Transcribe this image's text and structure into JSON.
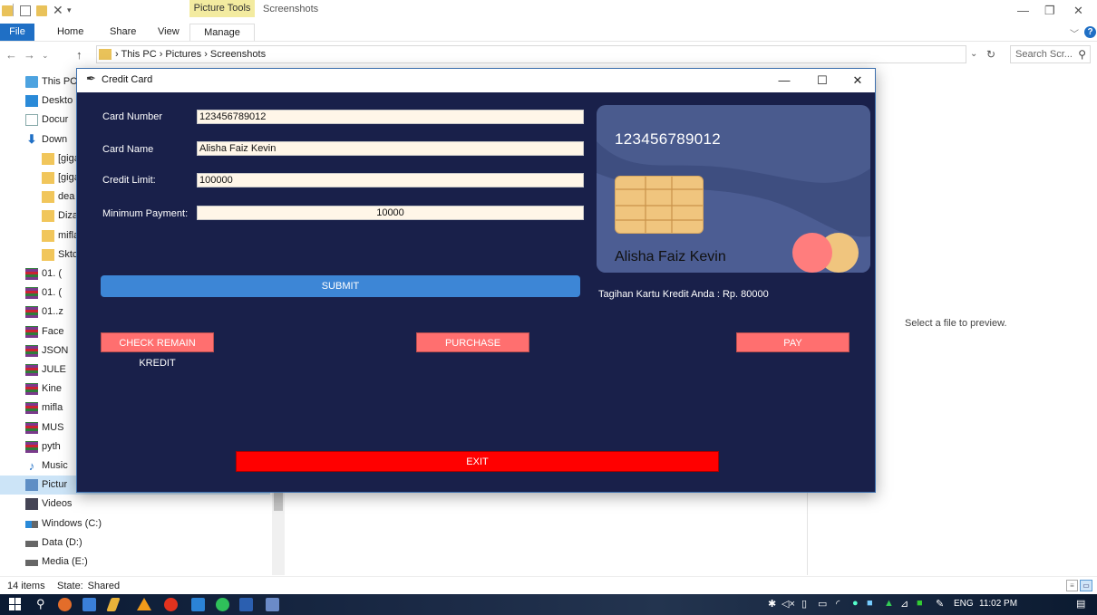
{
  "explorer": {
    "context_tab": "Picture Tools",
    "window_title": "Screenshots",
    "ribbon_tabs": [
      "File",
      "Home",
      "Share",
      "View",
      "Manage"
    ],
    "breadcrumb": "› This PC › Pictures › Screenshots",
    "search_placeholder": "Search Scr...",
    "nav_items": [
      {
        "label": "This PC",
        "icon": "computer-icon"
      },
      {
        "label": "Deskto",
        "icon": "desktop-icon"
      },
      {
        "label": "Docur",
        "icon": "document-icon"
      },
      {
        "label": "Down",
        "icon": "download-icon"
      },
      {
        "label": "[giga",
        "icon": "folder-icon"
      },
      {
        "label": "[giga",
        "icon": "folder-icon"
      },
      {
        "label": "dea",
        "icon": "folder-icon"
      },
      {
        "label": "Dizat",
        "icon": "folder-icon"
      },
      {
        "label": "mifla",
        "icon": "folder-icon"
      },
      {
        "label": "Sktcl",
        "icon": "folder-icon"
      },
      {
        "label": "01. (",
        "icon": "archive-icon"
      },
      {
        "label": "01. (",
        "icon": "archive-icon"
      },
      {
        "label": "01..z",
        "icon": "archive-icon"
      },
      {
        "label": "Face",
        "icon": "archive-icon"
      },
      {
        "label": "JSON",
        "icon": "archive-icon"
      },
      {
        "label": "JULE",
        "icon": "archive-icon"
      },
      {
        "label": "Kine",
        "icon": "archive-icon"
      },
      {
        "label": "mifla",
        "icon": "archive-icon"
      },
      {
        "label": "MUS",
        "icon": "archive-icon"
      },
      {
        "label": "pyth",
        "icon": "archive-icon"
      },
      {
        "label": "Music",
        "icon": "music-icon"
      },
      {
        "label": "Pictur",
        "icon": "pictures-icon"
      },
      {
        "label": "Videos",
        "icon": "videos-icon"
      },
      {
        "label": "Windows (C:)",
        "icon": "windows-drive-icon"
      },
      {
        "label": "Data (D:)",
        "icon": "drive-icon"
      },
      {
        "label": "Media (E:)",
        "icon": "drive-icon"
      }
    ],
    "preview_text": "Select a file to preview.",
    "status_count": "14 items",
    "status_state": "State:  Shared",
    "taskbar_time": "11:02 PM",
    "taskbar_lang": "ENG"
  },
  "cc_app": {
    "title": "Credit Card",
    "fields": {
      "card_number_label": "Card Number",
      "card_number_value": "123456789012",
      "card_name_label": "Card Name",
      "card_name_value": "Alisha Faiz Kevin",
      "credit_limit_label": "Credit Limit:",
      "credit_limit_value": "100000",
      "min_payment_label": "Minimum Payment:",
      "min_payment_value": "10000"
    },
    "submit_label": "SUBMIT",
    "card": {
      "number": "123456789012",
      "holder": "Alisha Faiz Kevin"
    },
    "bill_text": "Tagihan Kartu Kredit Anda : Rp. 80000",
    "buttons": {
      "check_remain": "CHECK REMAIN KREDIT",
      "purchase": "PURCHASE",
      "pay": "PAY",
      "exit": "EXIT"
    },
    "colors": {
      "background": "#19204a",
      "card": "#4a5b8e",
      "submit": "#3d86d6",
      "action": "#ff6f6f",
      "exit": "#ff0000",
      "chip": "#f0c57e"
    }
  }
}
